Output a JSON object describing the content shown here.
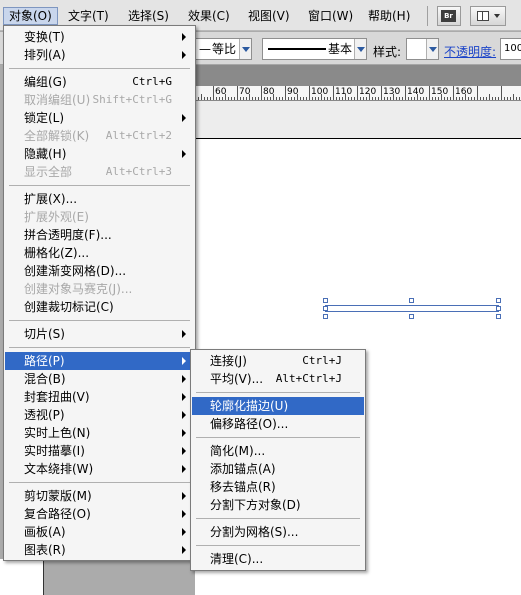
{
  "menubar": {
    "items": [
      {
        "label": "对象(O)",
        "active": true
      },
      {
        "label": "文字(T)"
      },
      {
        "label": "选择(S)"
      },
      {
        "label": "效果(C)"
      },
      {
        "label": "视图(V)"
      },
      {
        "label": "窗口(W)"
      },
      {
        "label": "帮助(H)"
      }
    ],
    "bridge_badge": "Br"
  },
  "control_bar": {
    "profile_value": "等比",
    "brush_value": "基本",
    "style_label": "样式:",
    "opacity_label": "不透明度:",
    "opacity_value": "100"
  },
  "ruler": {
    "labels": [
      "60",
      "70",
      "80",
      "90",
      "100",
      "110",
      "120",
      "130",
      "140",
      "150",
      "160"
    ]
  },
  "object_menu": {
    "items": [
      {
        "label": "变换(T)",
        "submenu": true
      },
      {
        "label": "排列(A)",
        "submenu": true
      },
      {
        "sep": true
      },
      {
        "label": "编组(G)",
        "shortcut": "Ctrl+G"
      },
      {
        "label": "取消编组(U)",
        "shortcut": "Shift+Ctrl+G",
        "disabled": true
      },
      {
        "label": "锁定(L)",
        "submenu": true
      },
      {
        "label": "全部解锁(K)",
        "shortcut": "Alt+Ctrl+2",
        "disabled": true
      },
      {
        "label": "隐藏(H)",
        "submenu": true
      },
      {
        "label": "显示全部",
        "shortcut": "Alt+Ctrl+3",
        "disabled": true
      },
      {
        "sep": true
      },
      {
        "label": "扩展(X)..."
      },
      {
        "label": "扩展外观(E)",
        "disabled": true
      },
      {
        "label": "拼合透明度(F)..."
      },
      {
        "label": "栅格化(Z)..."
      },
      {
        "label": "创建渐变网格(D)..."
      },
      {
        "label": "创建对象马赛克(J)...",
        "disabled": true
      },
      {
        "label": "创建裁切标记(C)"
      },
      {
        "sep": true
      },
      {
        "label": "切片(S)",
        "submenu": true
      },
      {
        "sep": true
      },
      {
        "label": "路径(P)",
        "submenu": true,
        "highlighted": true
      },
      {
        "label": "混合(B)",
        "submenu": true
      },
      {
        "label": "封套扭曲(V)",
        "submenu": true
      },
      {
        "label": "透视(P)",
        "submenu": true
      },
      {
        "label": "实时上色(N)",
        "submenu": true
      },
      {
        "label": "实时描摹(I)",
        "submenu": true
      },
      {
        "label": "文本绕排(W)",
        "submenu": true
      },
      {
        "sep": true
      },
      {
        "label": "剪切蒙版(M)",
        "submenu": true
      },
      {
        "label": "复合路径(O)",
        "submenu": true
      },
      {
        "label": "画板(A)",
        "submenu": true
      },
      {
        "label": "图表(R)",
        "submenu": true
      }
    ]
  },
  "path_submenu": {
    "items": [
      {
        "label": "连接(J)",
        "shortcut": "Ctrl+J"
      },
      {
        "label": "平均(V)...",
        "shortcut": "Alt+Ctrl+J"
      },
      {
        "sep": true
      },
      {
        "label": "轮廓化描边(U)",
        "highlighted": true
      },
      {
        "label": "偏移路径(O)..."
      },
      {
        "sep": true
      },
      {
        "label": "简化(M)..."
      },
      {
        "label": "添加锚点(A)"
      },
      {
        "label": "移去锚点(R)"
      },
      {
        "label": "分割下方对象(D)"
      },
      {
        "sep": true
      },
      {
        "label": "分割为网格(S)..."
      },
      {
        "sep": true
      },
      {
        "label": "清理(C)..."
      }
    ]
  }
}
